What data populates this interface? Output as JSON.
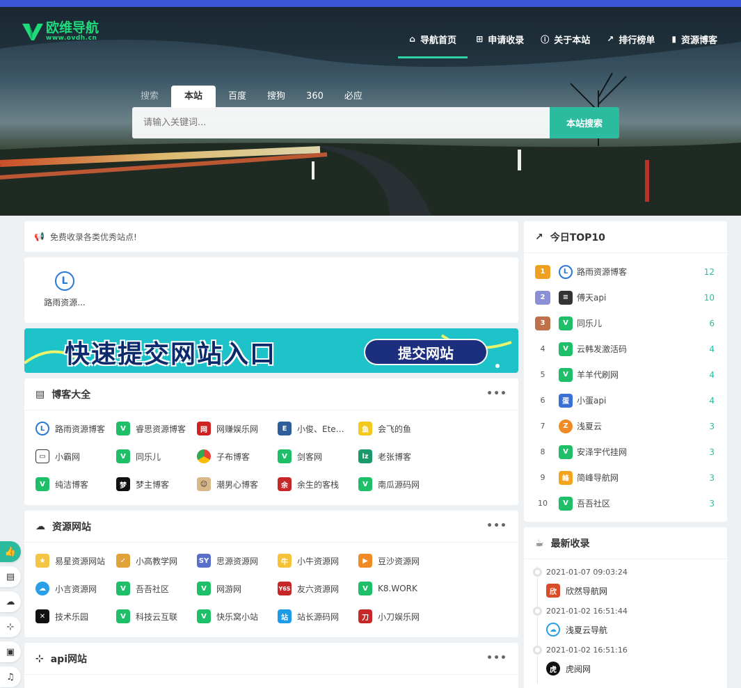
{
  "logo": {
    "title": "欧维导航",
    "url": "www.ovdh.cn"
  },
  "nav": [
    {
      "label": "导航首页",
      "icon": "home-icon",
      "active": true
    },
    {
      "label": "申请收录",
      "icon": "plus-square-icon"
    },
    {
      "label": "关于本站",
      "icon": "info-circle-icon"
    },
    {
      "label": "排行榜单",
      "icon": "line-chart-icon"
    },
    {
      "label": "资源博客",
      "icon": "bookmark-icon"
    }
  ],
  "search": {
    "tabs": [
      "搜索",
      "本站",
      "百度",
      "搜狗",
      "360",
      "必应"
    ],
    "active_tab": "本站",
    "placeholder": "请输入关键词...",
    "button": "本站搜索"
  },
  "notice": {
    "text": "免费收录各类优秀站点!"
  },
  "recent": {
    "name": "路雨资源..."
  },
  "banner": {
    "text": "快速提交网站入口",
    "button": "提交网站"
  },
  "blogs": {
    "title": "博客大全",
    "more": "•••",
    "items": [
      "路雨资源博客",
      "睿思资源博客",
      "网赚娱乐网",
      "小俊、Ete博客",
      "会飞的鱼",
      "小霸网",
      "同乐儿",
      "子布博客",
      "剑客网",
      "老张博客",
      "纯洁博客",
      "梦主博客",
      "潮男心博客",
      "余生的客栈",
      "南瓜源码网"
    ]
  },
  "resources": {
    "title": "资源网站",
    "more": "•••",
    "items": [
      "易星资源网站",
      "小高教学网",
      "思源资源网",
      "小牛资源网",
      "豆沙资源网",
      "小言资源网",
      "吾吾社区",
      "网游网",
      "友六资源网",
      "K8.WORK",
      "技术乐园",
      "科技云互联",
      "快乐窝小站",
      "站长源码网",
      "小刀娱乐网"
    ]
  },
  "apis": {
    "title": "api网站",
    "more": "•••"
  },
  "top10": {
    "title": "今日TOP10",
    "items": [
      {
        "rank": "1",
        "name": "路雨资源博客",
        "count": "12"
      },
      {
        "rank": "2",
        "name": "傅天api",
        "count": "10"
      },
      {
        "rank": "3",
        "name": "同乐儿",
        "count": "6"
      },
      {
        "rank": "4",
        "name": "云韩发激活码",
        "count": "4"
      },
      {
        "rank": "5",
        "name": "羊羊代刷网",
        "count": "4"
      },
      {
        "rank": "6",
        "name": "小蛋api",
        "count": "4"
      },
      {
        "rank": "7",
        "name": "浅夏云",
        "count": "3"
      },
      {
        "rank": "8",
        "name": "安泽宇代挂网",
        "count": "3"
      },
      {
        "rank": "9",
        "name": "简峰导航网",
        "count": "3"
      },
      {
        "rank": "10",
        "name": "吾吾社区",
        "count": "3"
      }
    ]
  },
  "latest": {
    "title": "最新收录",
    "items": [
      {
        "time": "2021-01-07 09:03:24",
        "name": "欣然导航网"
      },
      {
        "time": "2021-01-02 16:51:44",
        "name": "浅夏云导航"
      },
      {
        "time": "2021-01-02 16:51:16",
        "name": "虎阅网"
      }
    ]
  },
  "colors": {
    "accent": "#2bbca0",
    "topstrip": "#3b56d8",
    "logo": "#1fd97a"
  }
}
